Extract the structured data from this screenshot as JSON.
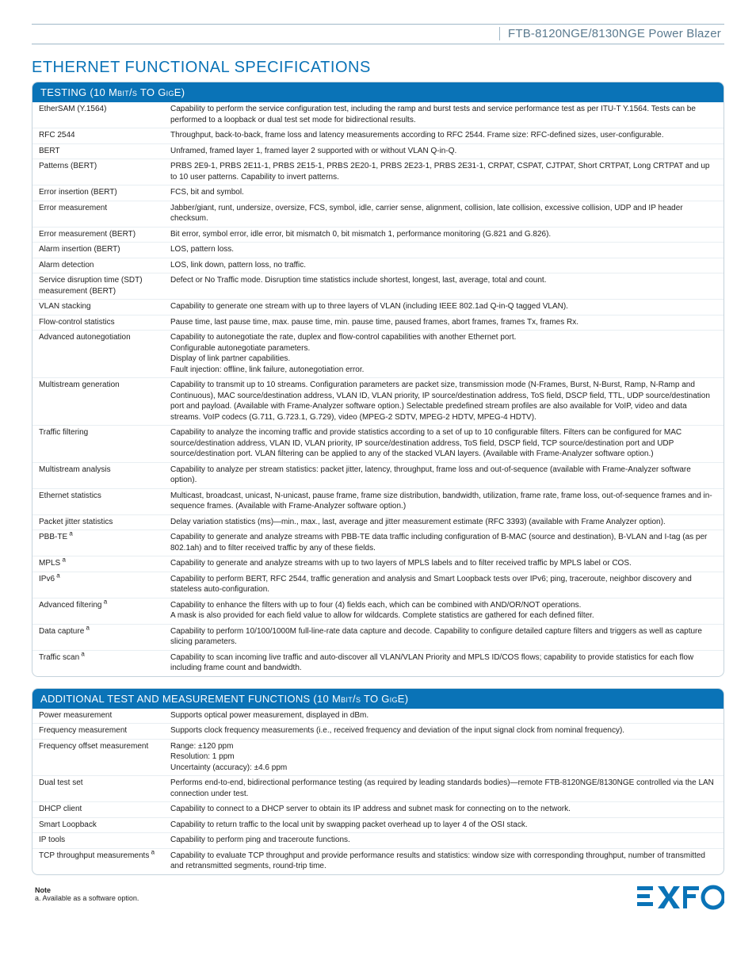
{
  "header": {
    "product": "FTB-8120NGE/8130NGE Power Blazer"
  },
  "title": "ETHERNET FUNCTIONAL SPECIFICATIONS",
  "tables": [
    {
      "header_html": "TESTING (10 M<span class=\"sc\">bit</span>/<span class=\"sc\">s</span> TO G<span class=\"sc\">ig</span>E)",
      "rows": [
        {
          "label": "EtherSAM (Y.1564)",
          "value": "Capability to perform the service configuration test, including the ramp and burst tests and service performance test as per ITU-T Y.1564. Tests can be performed to a loopback or dual test set mode for bidirectional results."
        },
        {
          "label": "RFC 2544",
          "value": "Throughput, back-to-back, frame loss and latency measurements according to RFC 2544. Frame size: RFC-defined sizes, user-configurable."
        },
        {
          "label": "BERT",
          "value": "Unframed, framed layer 1, framed layer 2 supported with or without VLAN Q-in-Q."
        },
        {
          "label": "Patterns (BERT)",
          "value": "PRBS 2E9-1, PRBS 2E11-1, PRBS 2E15-1, PRBS 2E20-1, PRBS 2E23-1, PRBS 2E31-1, CRPAT, CSPAT, CJTPAT, Short CRTPAT, Long CRTPAT and up to 10 user patterns. Capability to invert patterns."
        },
        {
          "label": "Error insertion (BERT)",
          "value": "FCS, bit and symbol."
        },
        {
          "label": "Error measurement",
          "value": "Jabber/giant, runt, undersize, oversize, FCS, symbol, idle, carrier sense, alignment, collision, late collision, excessive collision, UDP and IP header checksum."
        },
        {
          "label": "Error measurement (BERT)",
          "value": "Bit error, symbol error, idle error, bit mismatch 0, bit mismatch 1, performance monitoring (G.821 and G.826)."
        },
        {
          "label": "Alarm insertion (BERT)",
          "value": "LOS, pattern loss."
        },
        {
          "label": "Alarm detection",
          "value": "LOS, link down, pattern loss, no traffic."
        },
        {
          "label": "Service disruption time (SDT) measurement (BERT)",
          "value": "Defect or No Traffic mode. Disruption time statistics include shortest, longest, last, average, total and count."
        },
        {
          "label": "VLAN stacking",
          "value": "Capability to generate one stream with up to three layers of VLAN (including IEEE 802.1ad Q-in-Q tagged VLAN)."
        },
        {
          "label": "Flow-control statistics",
          "value": "Pause time, last pause time, max. pause time, min. pause time, paused frames, abort frames, frames Tx, frames Rx."
        },
        {
          "label": "Advanced autonegotiation",
          "value": "Capability to autonegotiate the rate, duplex and flow-control capabilities with another Ethernet port.\nConfigurable autonegotiate parameters.\nDisplay of link partner capabilities.\nFault injection: offline, link failure, autonegotiation error."
        },
        {
          "label": "Multistream generation",
          "value": "Capability to transmit up to 10 streams. Configuration parameters are packet size, transmission mode (N-Frames, Burst, N-Burst, Ramp, N-Ramp and Continuous), MAC source/destination address, VLAN ID, VLAN priority, IP source/destination address, ToS field, DSCP field, TTL, UDP source/destination port and payload. (Available with Frame-Analyzer software option.) Selectable predefined stream profiles are also available for VoIP, video and data streams. VoIP codecs (G.711, G.723.1, G.729), video (MPEG-2 SDTV, MPEG-2 HDTV, MPEG-4 HDTV)."
        },
        {
          "label": "Traffic filtering",
          "value": "Capability to analyze the incoming traffic and provide statistics according to a set of up to 10 configurable filters. Filters can be configured for MAC source/destination address, VLAN ID, VLAN priority, IP source/destination address, ToS field, DSCP field, TCP source/destination port and UDP source/destination port. VLAN filtering can be applied to any of the stacked VLAN layers. (Available with Frame-Analyzer software option.)"
        },
        {
          "label": "Multistream analysis",
          "value": "Capability to analyze per stream statistics: packet jitter, latency, throughput, frame loss and out-of-sequence (available with Frame-Analyzer software option)."
        },
        {
          "label": "Ethernet statistics",
          "value": "Multicast, broadcast, unicast, N-unicast, pause frame, frame size distribution, bandwidth, utilization, frame rate, frame loss, out-of-sequence frames and in-sequence frames. (Available with Frame-Analyzer software option.)"
        },
        {
          "label": "Packet jitter statistics",
          "value": "Delay variation statistics (ms)—min., max., last, average and jitter measurement estimate (RFC 3393) (available with Frame Analyzer option)."
        },
        {
          "label_html": "PBB-TE<sup> a</sup>",
          "value": "Capability to generate and analyze streams with PBB-TE data traffic including configuration of B-MAC (source and destination), B-VLAN and I-tag (as per 802.1ah) and to filter received traffic by any of these fields."
        },
        {
          "label_html": "MPLS<sup> a</sup>",
          "value": "Capability to generate and analyze streams with up to two layers of MPLS labels and to filter received traffic by MPLS label or COS."
        },
        {
          "label_html": "IPv6<sup> a</sup>",
          "value": "Capability to perform BERT, RFC 2544, traffic generation and analysis and Smart Loopback tests over IPv6; ping, traceroute, neighbor discovery and stateless auto-configuration."
        },
        {
          "label_html": "Advanced filtering<sup> a</sup>",
          "value": "Capability to enhance the filters with up to four (4) fields each, which can be combined with AND/OR/NOT operations.\nA mask is also provided for each field value to allow for wildcards. Complete statistics are gathered for each defined filter."
        },
        {
          "label_html": "Data capture<sup> a</sup>",
          "value": "Capability to perform 10/100/1000M full-line-rate data capture and decode. Capability to configure detailed capture filters and triggers as well as capture slicing parameters."
        },
        {
          "label_html": "Traffic scan<sup> a</sup>",
          "value": "Capability to scan incoming live traffic and auto-discover all VLAN/VLAN Priority and MPLS ID/COS flows; capability to provide statistics for each flow including frame count and bandwidth."
        }
      ]
    },
    {
      "header_html": "ADDITIONAL TEST AND MEASUREMENT FUNCTIONS (10 M<span class=\"sc\">bit</span>/<span class=\"sc\">s</span> TO G<span class=\"sc\">ig</span>E)",
      "rows": [
        {
          "label": "Power measurement",
          "value": "Supports optical power measurement, displayed in dBm."
        },
        {
          "label": "Frequency measurement",
          "value": "Supports clock frequency measurements (i.e., received frequency and deviation of the input signal clock from nominal frequency)."
        },
        {
          "label": "Frequency offset measurement",
          "value": "Range: ±120 ppm\nResolution: 1 ppm\nUncertainty (accuracy): ±4.6 ppm"
        },
        {
          "label": "Dual test set",
          "value": "Performs end-to-end, bidirectional performance testing (as required by leading standards bodies)—remote FTB-8120NGE/8130NGE controlled via the LAN connection under test."
        },
        {
          "label": "DHCP client",
          "value": "Capability to connect to a DHCP server to obtain its IP address and subnet mask for connecting on to the network."
        },
        {
          "label": "Smart Loopback",
          "value": "Capability to return traffic to the local unit by swapping packet overhead up to layer 4 of the OSI stack."
        },
        {
          "label": "IP tools",
          "value": "Capability to perform ping and traceroute functions."
        },
        {
          "label_html": "TCP throughput measurements<sup> a</sup>",
          "value": "Capability to evaluate TCP throughput and provide performance results and statistics: window size with corresponding throughput, number of transmitted and retransmitted segments, round-trip time."
        }
      ]
    }
  ],
  "note": {
    "heading": "Note",
    "text": "a. Available as a software option."
  },
  "brand": "EXFO"
}
